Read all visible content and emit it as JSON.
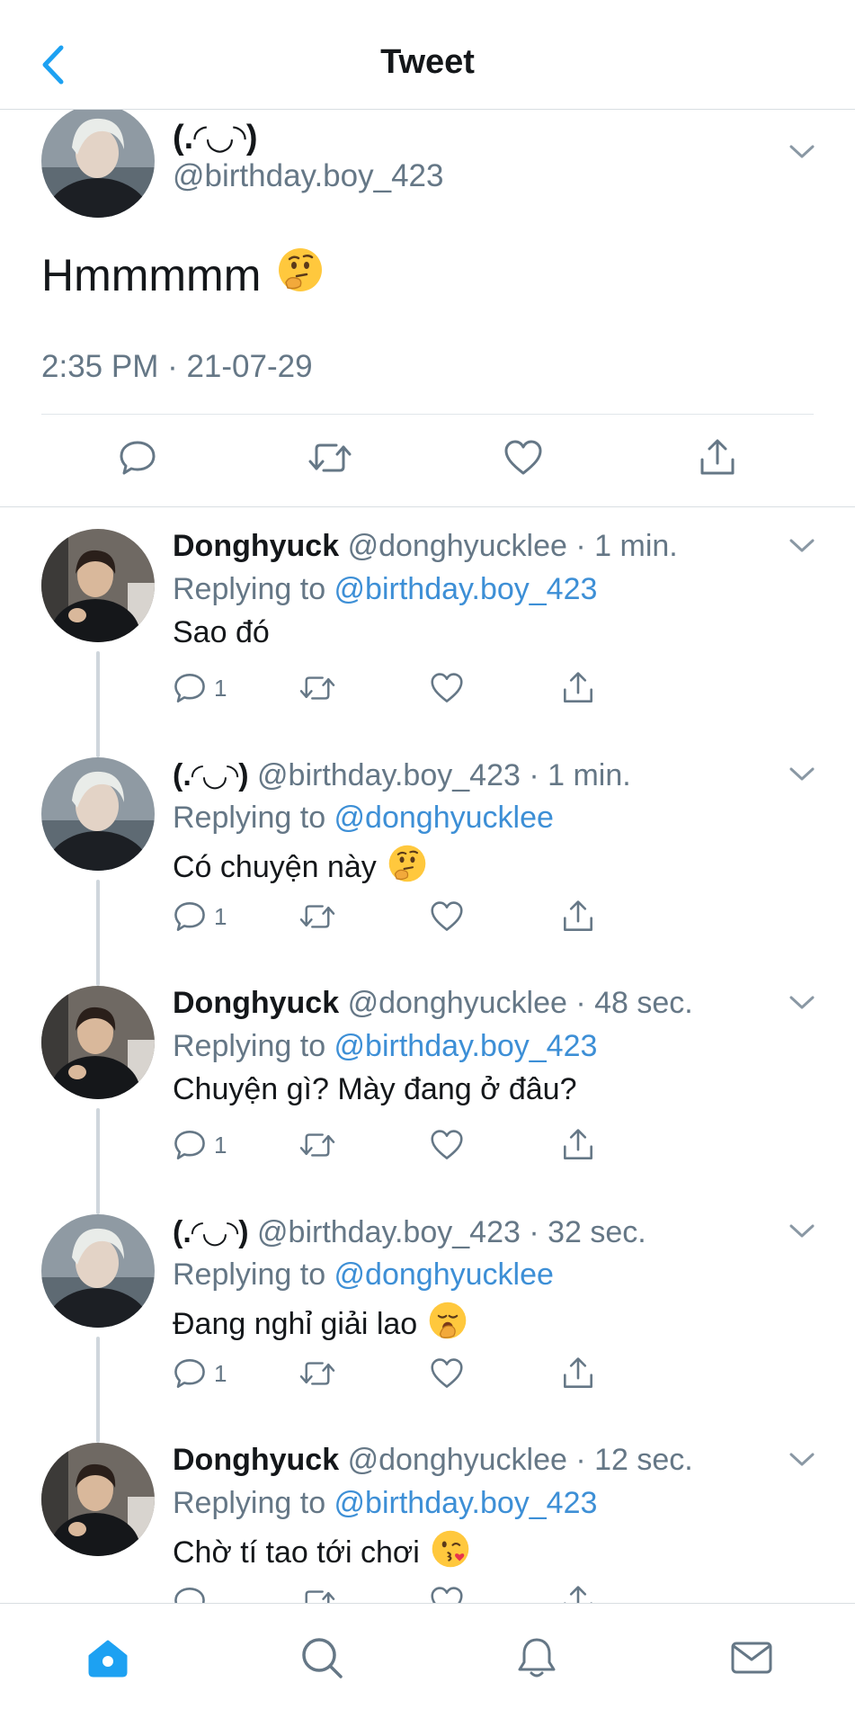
{
  "header": {
    "title": "Tweet"
  },
  "main_tweet": {
    "name": "(.◜◡◝)",
    "handle": "@birthday.boy_423",
    "text": "Hmmmmm",
    "emoji": "thinking-face",
    "timestamp": "2:35 PM · 21-07-29"
  },
  "replies": [
    {
      "name": "Donghyuck",
      "handle_time": "@donghyucklee · 1 min.",
      "replying_label": "Replying to ",
      "replying_to": "@birthday.boy_423",
      "text": "Sao đó",
      "emoji": "",
      "reply_count": "1",
      "avatar": "donghyuck"
    },
    {
      "name": "(.◜◡◝)",
      "handle_time": "@birthday.boy_423 · 1 min.",
      "replying_label": "Replying to ",
      "replying_to": "@donghyucklee",
      "text": "Có chuyện này",
      "emoji": "thinking-face",
      "reply_count": "1",
      "avatar": "birthday"
    },
    {
      "name": "Donghyuck",
      "handle_time": "@donghyucklee · 48 sec.",
      "replying_label": "Replying to ",
      "replying_to": "@birthday.boy_423",
      "text": "Chuyện gì? Mày đang ở đâu?",
      "emoji": "",
      "reply_count": "1",
      "avatar": "donghyuck"
    },
    {
      "name": "(.◜◡◝)",
      "handle_time": "@birthday.boy_423 · 32 sec.",
      "replying_label": "Replying to ",
      "replying_to": "@donghyucklee",
      "text": "Đang nghỉ giải lao",
      "emoji": "yawning-face",
      "reply_count": "1",
      "avatar": "birthday"
    },
    {
      "name": "Donghyuck",
      "handle_time": "@donghyucklee · 12 sec.",
      "replying_label": "Replying to ",
      "replying_to": "@birthday.boy_423",
      "text": "Chờ tí tao tới chơi",
      "emoji": "kissing-heart-face",
      "reply_count": "",
      "avatar": "donghyuck"
    }
  ],
  "tabbar": {
    "active": "home",
    "tabs": [
      "home",
      "search",
      "notifications",
      "messages"
    ]
  },
  "colors": {
    "accent": "#1da1f2",
    "link": "#3d8fd6",
    "secondary_text": "#657786",
    "divider": "#d9dee2"
  }
}
